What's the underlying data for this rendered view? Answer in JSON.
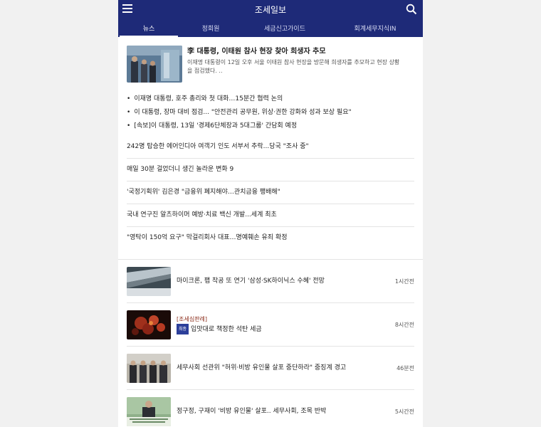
{
  "app": {
    "title": "조세일보"
  },
  "tabs": [
    {
      "label": "뉴스",
      "active": true
    },
    {
      "label": "정회원",
      "active": false
    },
    {
      "label": "세금신고가이드",
      "active": false
    },
    {
      "label": "회계세무지식IN",
      "active": false
    }
  ],
  "lead": {
    "headline": "李 대통령, 이태원 참사 현장 찾아 희생자 추모",
    "summary_line1": "이재명 대통령이 12일 오후 서울 이태원 참사 현장을 방문해 희생자를 추모하고 현장 상황",
    "summary_line2": "을 점검했다. .."
  },
  "bullets": [
    "이재명 대통령, 호주 총리와 첫 대화…15분간 협력 논의",
    "이 대통령, 장마 대비 점검... \"안전관리 공무원, 위상·권한 강화와 성과 보상 필요\"",
    "[속보]이 대통령, 13일 '경제6단체장과 5대그룹' 간담회 예정"
  ],
  "headlines": [
    "242명 탑승한 에어인디아 여객기 인도 서부서 추락...당국 \"조사 중\"",
    "매일 30분 걸었더니 생긴 놀라운 변화 9",
    "'국정기획위' 김은경 \"금융위 폐지해야…관치금융 팽배해\"",
    "국내 연구진 알츠하이머 예방·치료 백신 개발...세계 최초",
    "\"영탁이 150억 요구\" 막걸리회사 대표…명예훼손 유죄 확정"
  ],
  "articles": [
    {
      "title": "마이크론, 팹 착공 또 연기 '삼성·SK하이닉스 수혜' 전망",
      "time": "1시간전"
    },
    {
      "tag": "[조세심판례]",
      "badge": "최종",
      "title": "입맛대로 책정한 석탄 세금",
      "time": "8시간전"
    },
    {
      "title": "세무사회 선관위 \"허위·비방 유인물 살포 중단하라\" 중징계 경고",
      "time": "46분전"
    },
    {
      "title": "정구정, 구재이 '비방 유인물' 살포.. 세무사회, 조목 반박",
      "time": "5시간전"
    }
  ],
  "colors": {
    "header_bg": "#1e2a78",
    "tag_color": "#8b2c1a",
    "badge_bg": "#2c3f9a"
  }
}
